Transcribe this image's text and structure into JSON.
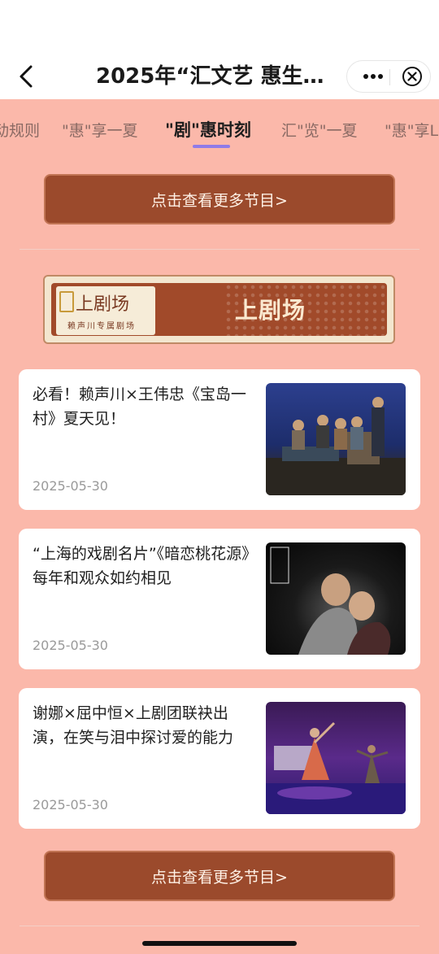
{
  "nav": {
    "title": "2025年“汇文艺 惠生…"
  },
  "tabs": [
    {
      "label": "动规则"
    },
    {
      "label": "\"惠\"享一夏"
    },
    {
      "label": "\"剧\"惠时刻"
    },
    {
      "label": "汇\"览\"一夏"
    },
    {
      "label": "\"惠\"享L"
    }
  ],
  "more_button": {
    "label": "点击查看更多节目>"
  },
  "banner": {
    "logo_text": "上剧场",
    "logo_subtext": "赖声川专属剧场",
    "title": "上剧场"
  },
  "articles": [
    {
      "title": "必看！赖声川×王伟忠《宝岛一村》夏天见！",
      "date": "2025-05-30",
      "thumb": "stage-photo-family-scene"
    },
    {
      "title": "“上海的戏剧名片”《暗恋桃花源》每年和观众如约相见",
      "date": "2025-05-30",
      "thumb": "stage-photo-embrace"
    },
    {
      "title": "谢娜×屈中恒×上剧团联袂出演，在笑与泪中探讨爱的能力",
      "date": "2025-05-30",
      "thumb": "stage-photo-dance"
    }
  ],
  "colors": {
    "background": "#fbb8aa",
    "button": "#9b4a2c",
    "tab_indicator": "#8f7be8"
  }
}
